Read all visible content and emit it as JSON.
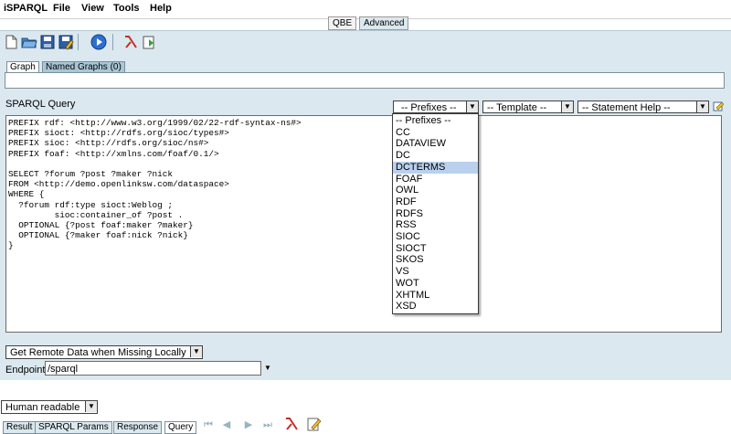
{
  "menubar": {
    "app": "iSPARQL",
    "items": [
      "File",
      "View",
      "Tools",
      "Help"
    ]
  },
  "modes": {
    "qbe": "QBE",
    "advanced": "Advanced"
  },
  "toolbar": {
    "icons": [
      "new-document-icon",
      "open-folder-icon",
      "save-icon",
      "save-as-icon",
      "run-query-icon",
      "lambda-icon",
      "import-icon"
    ]
  },
  "graph_tabs": {
    "graph": "Graph",
    "named_graphs": "Named Graphs (0)"
  },
  "query": {
    "label": "SPARQL Query",
    "prefixes_select": "-- Prefixes --",
    "template_select": "-- Template --",
    "statement_help_select": "-- Statement Help --",
    "lines": [
      "PREFIX rdf: <http://www.w3.org/1999/02/22-rdf-syntax-ns#>",
      "PREFIX sioct: <http://rdfs.org/sioc/types#>",
      "PREFIX sioc: <http://rdfs.org/sioc/ns#>",
      "PREFIX foaf: <http://xmlns.com/foaf/0.1/>",
      "",
      "SELECT ?forum ?post ?maker ?nick",
      "FROM <http://demo.openlinksw.com/dataspace>",
      "WHERE {",
      "  ?forum rdf:type sioct:Weblog ;",
      "         sioc:container_of ?post .",
      "  OPTIONAL {?post foaf:maker ?maker}",
      "  OPTIONAL {?maker foaf:nick ?nick}",
      "}"
    ]
  },
  "prefix_dropdown": {
    "selected": "DCTERMS",
    "options": [
      "-- Prefixes --",
      "CC",
      "DATAVIEW",
      "DC",
      "DCTERMS",
      "FOAF",
      "OWL",
      "RDF",
      "RDFS",
      "RSS",
      "SIOC",
      "SIOCT",
      "SKOS",
      "VS",
      "WOT",
      "XHTML",
      "XSD"
    ]
  },
  "options": {
    "remote_data": "Get Remote Data when Missing Locally",
    "endpoint_label": "Endpoint",
    "endpoint_value": "/sparql"
  },
  "output": {
    "format": "Human readable",
    "tabs": [
      "Result",
      "SPARQL Params",
      "Response",
      "Query"
    ],
    "active_tab": "Query"
  },
  "colors": {
    "panel": "#dbe8ef",
    "selection": "#b9d1ee"
  }
}
